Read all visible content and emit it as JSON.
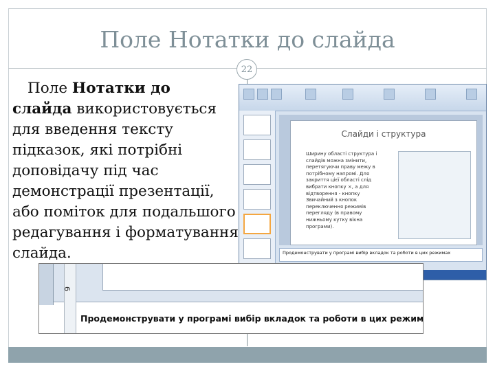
{
  "slide": {
    "title": "Поле Нотатки до слайда",
    "number": "22",
    "body": {
      "bold1": "Нотатки до",
      "prefix": "Поле ",
      "bold2": "слайда",
      "rest": " використовується для введення тексту підказок, які потрібні доповідачу під час демонстрації презентації, або поміток для подальшого редагування і форматування слайда."
    }
  },
  "screenshot": {
    "inner_slide_title": "Слайди і структура",
    "inner_text": "Ширину області структура і слайдів можна змінити, перетягуючи праву межу в потрібному напрямі. Для закриття цієї області слід вибрати кнопку ×, а для відтворення - кнопку Звичайний з кнопок переключення режимів перегляду (в правому нижньому кутку вікна програми).",
    "notes_text": "Продемонструвати у програмі вибір вкладок та роботи в цих режимах",
    "zoom_line_number": "9",
    "zoom_notes_text": "Продемонструвати у програмі вибір вкладок та роботи в цих режимах"
  },
  "colors": {
    "title": "#7e8f97",
    "footer_band": "#8fa3ac",
    "status_bar": "#2e5ea8"
  }
}
